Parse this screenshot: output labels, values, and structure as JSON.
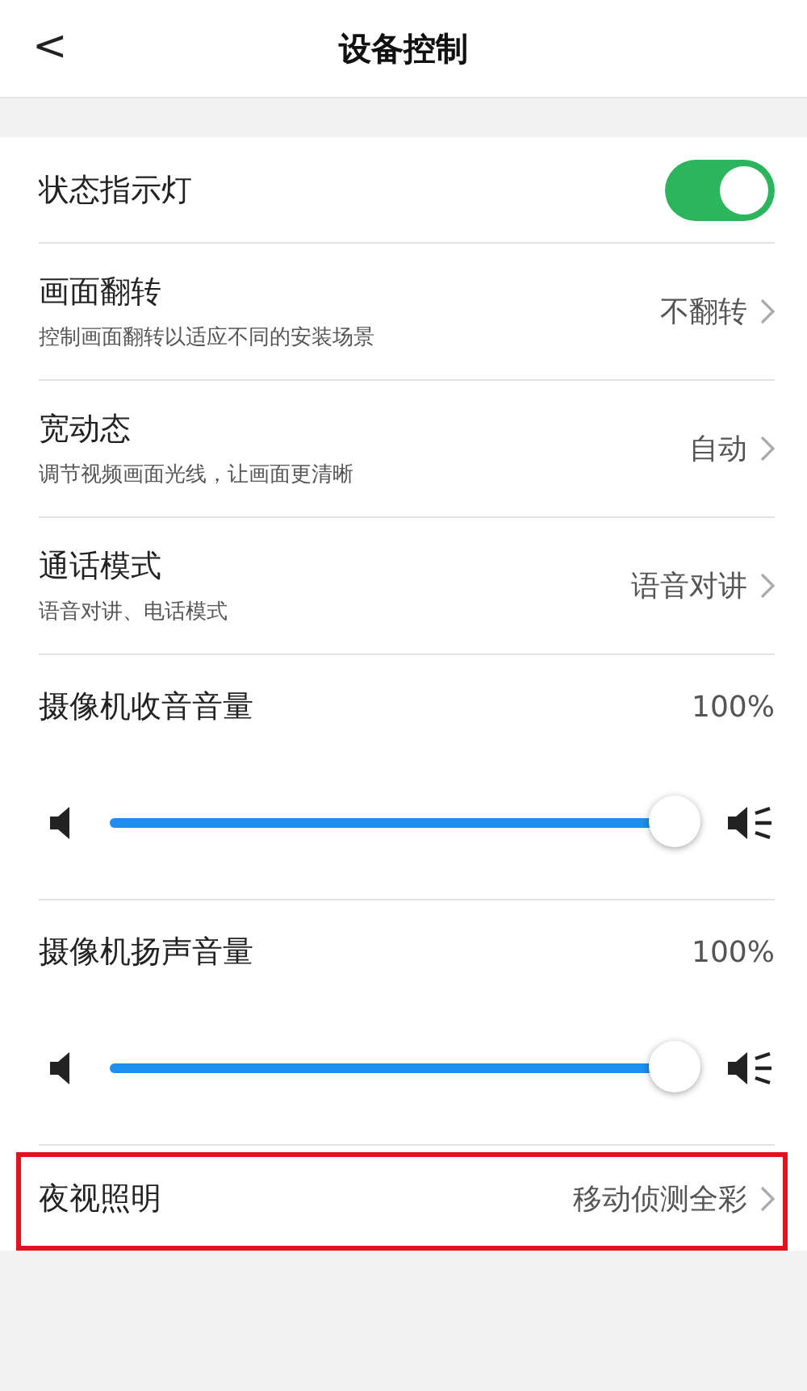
{
  "header": {
    "back": "<",
    "title": "设备控制"
  },
  "settings": [
    {
      "kind": "toggle",
      "label": "状态指示灯",
      "on": true
    },
    {
      "kind": "option",
      "label": "画面翻转",
      "description": "控制画面翻转以适应不同的安装场景",
      "value": "不翻转"
    },
    {
      "kind": "option",
      "label": "宽动态",
      "description": "调节视频画面光线，让画面更清晰",
      "value": "自动"
    },
    {
      "kind": "option",
      "label": "通话模式",
      "description": "语音对讲、电话模式",
      "value": "语音对讲"
    },
    {
      "kind": "volume",
      "label": "摄像机收音音量",
      "reading": "100%",
      "level": 1
    },
    {
      "kind": "volume",
      "label": "摄像机扬声音量",
      "reading": "100%",
      "level": 1
    },
    {
      "kind": "option",
      "label": "夜视照明",
      "value": "移动侦测全彩",
      "highlighted": true
    }
  ]
}
